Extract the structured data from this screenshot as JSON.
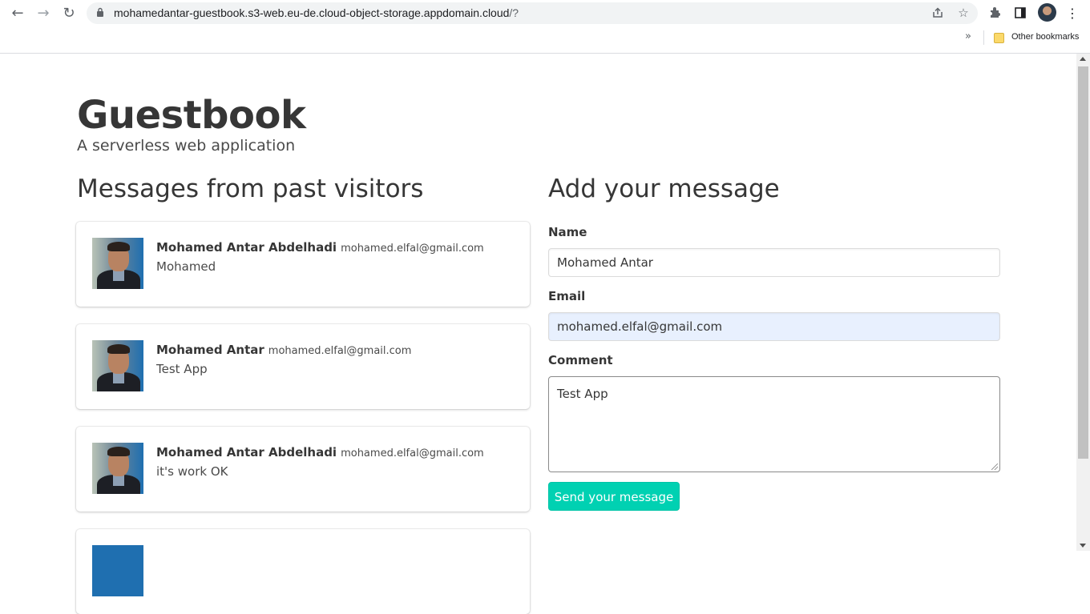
{
  "browser": {
    "url_main": "mohamedantar-guestbook.s3-web.eu-de.cloud-object-storage.appdomain.cloud",
    "url_rest": "/?",
    "bookmarks_more": "»",
    "other_bookmarks": "Other bookmarks"
  },
  "header": {
    "title": "Guestbook",
    "subtitle": "A serverless web application"
  },
  "messages": {
    "heading": "Messages from past visitors",
    "items": [
      {
        "name": "Mohamed Antar Abdelhadi",
        "email": "mohamed.elfal@gmail.com",
        "comment": "Mohamed"
      },
      {
        "name": "Mohamed Antar",
        "email": "mohamed.elfal@gmail.com",
        "comment": "Test App"
      },
      {
        "name": "Mohamed Antar Abdelhadi",
        "email": "mohamed.elfal@gmail.com",
        "comment": "it's work OK"
      }
    ]
  },
  "form": {
    "heading": "Add your message",
    "name_label": "Name",
    "name_value": "Mohamed Antar",
    "email_label": "Email",
    "email_value": "mohamed.elfal@gmail.com",
    "comment_label": "Comment",
    "comment_value": "Test App",
    "submit_label": "Send your message"
  },
  "colors": {
    "primary_button": "#00d1b2",
    "autofill_bg": "#e8f0fe"
  }
}
